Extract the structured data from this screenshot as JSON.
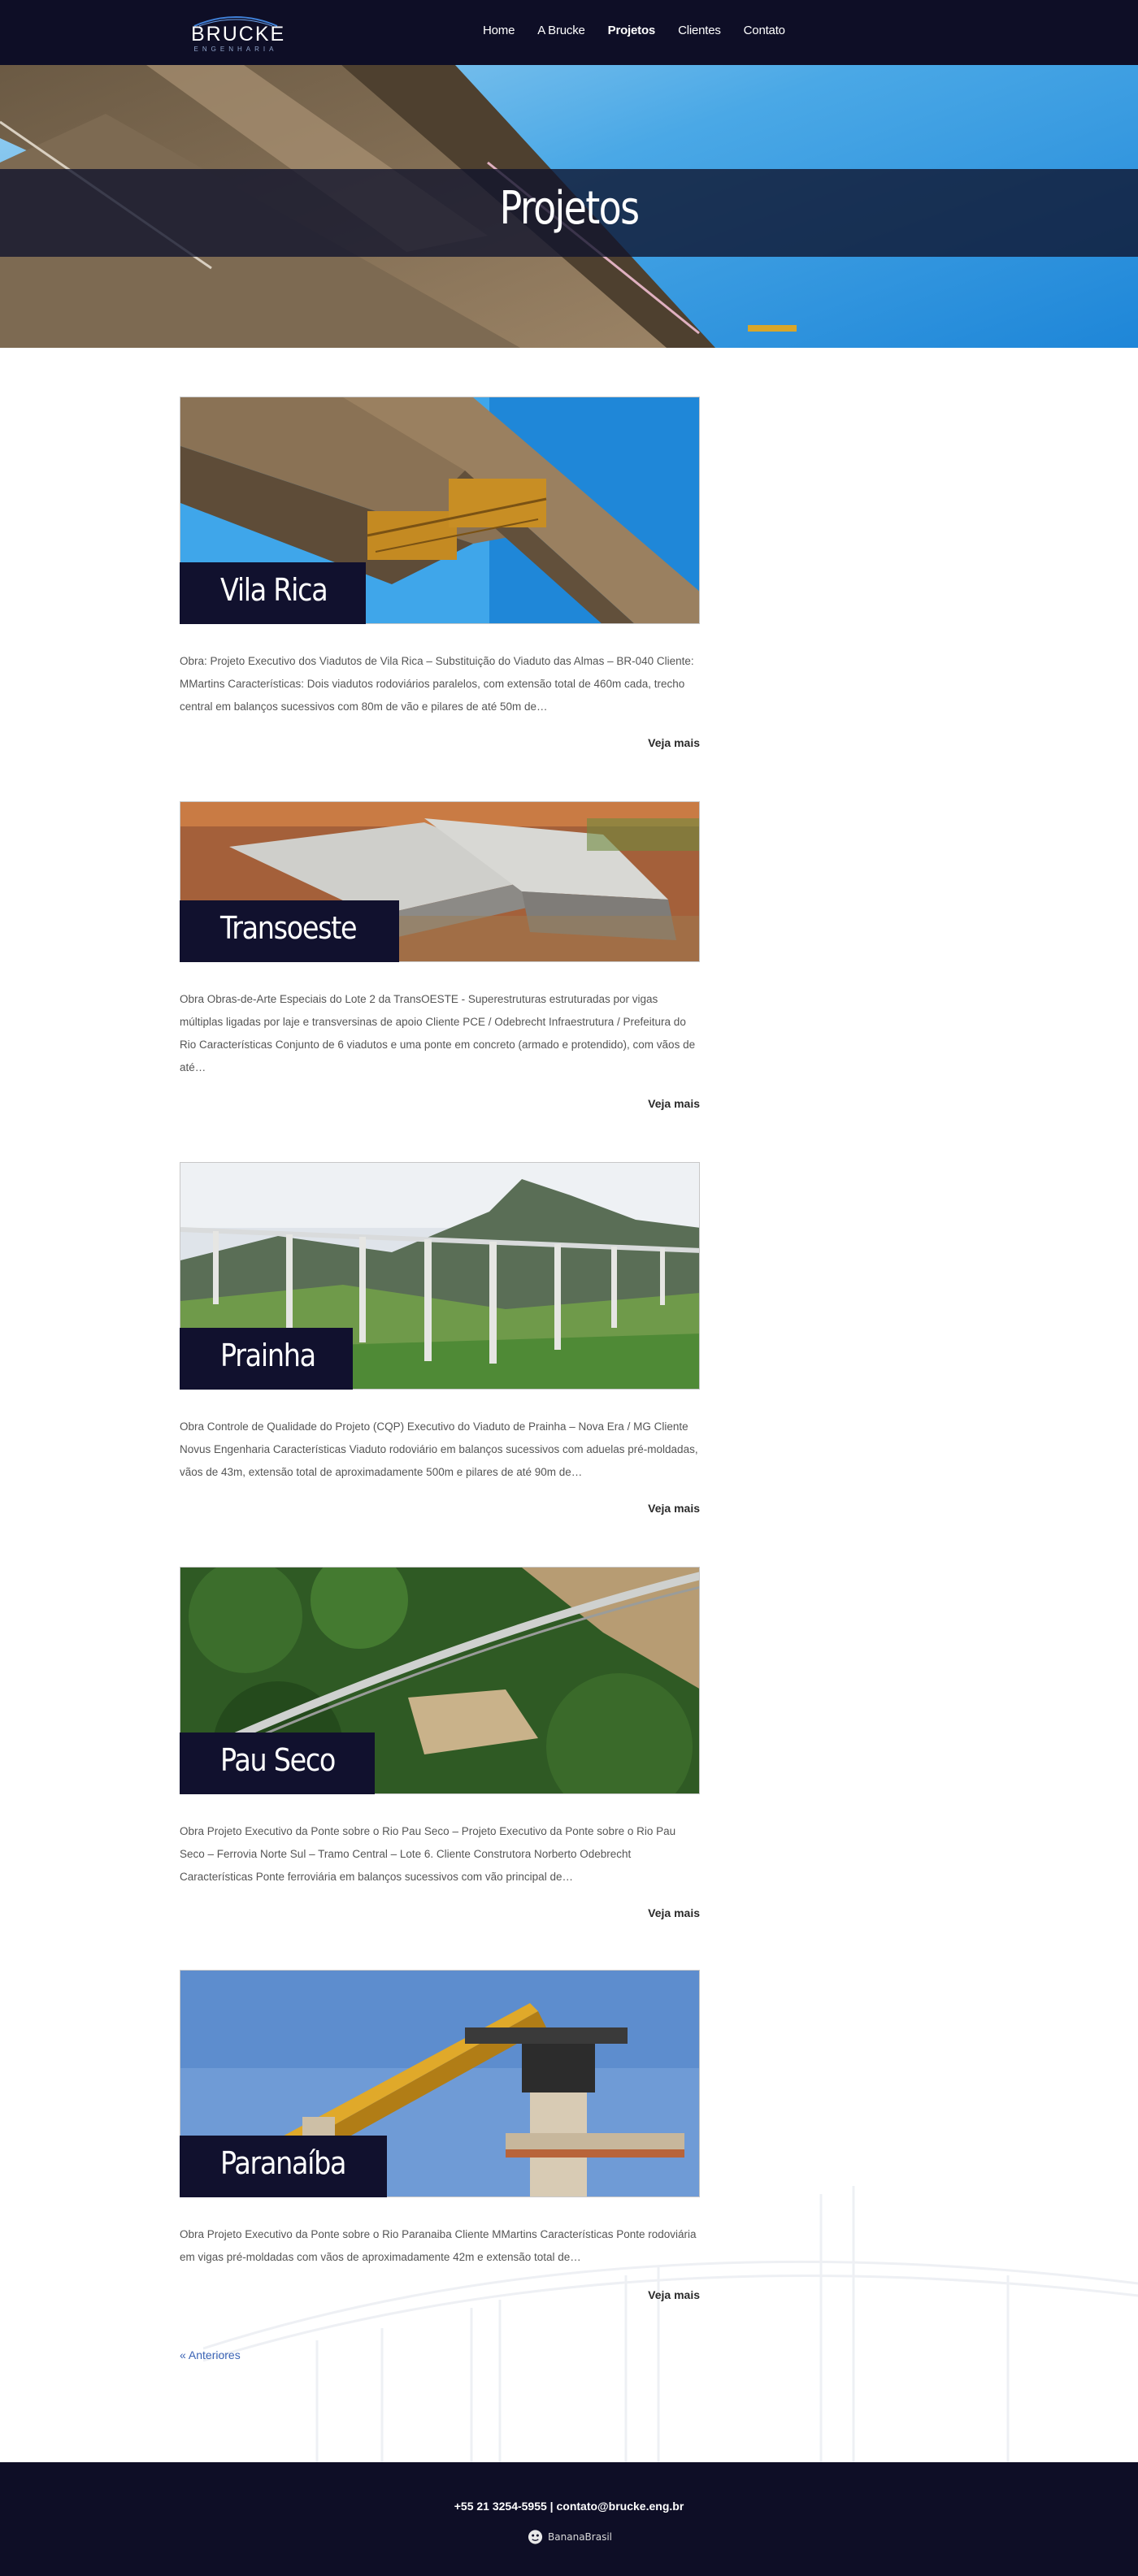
{
  "header": {
    "logo_text": "BRUCKE",
    "logo_sub": "ENGENHARIA",
    "nav": [
      {
        "label": "Home",
        "active": false
      },
      {
        "label": "A Brucke",
        "active": false
      },
      {
        "label": "Projetos",
        "active": true
      },
      {
        "label": "Clientes",
        "active": false
      },
      {
        "label": "Contato",
        "active": false
      }
    ]
  },
  "hero": {
    "title": "Projetos"
  },
  "posts": [
    {
      "title": "Vila Rica",
      "image": "viaduct-cantilever-photo",
      "excerpt": "Obra: Projeto Executivo dos Viadutos de Vila Rica – Substituição do Viaduto das Almas – BR-040 Cliente: MMartins Características: Dois viadutos rodoviários paralelos, com extensão total de 460m cada, trecho central em balanços sucessivos com 80m de vão e pilares de até 50m de…",
      "more": "Veja mais"
    },
    {
      "title": "Transoeste",
      "image": "concrete-viaduct-construction-photo",
      "excerpt": "Obra Obras-de-Arte Especiais do Lote 2 da TransOESTE - Superestruturas estruturadas por vigas múltiplas ligadas por laje e transversinas de apoio Cliente PCE / Odebrecht Infraestrutura / Prefeitura do Rio Características Conjunto de 6 viadutos e uma ponte em concreto (armado e protendido), com vãos de até…",
      "more": "Veja mais"
    },
    {
      "title": "Prainha",
      "image": "mountain-viaduct-photo",
      "excerpt": "Obra Controle de Qualidade do Projeto (CQP) Executivo do Viaduto de Prainha – Nova Era / MG Cliente Novus Engenharia Características Viaduto rodoviário em balanços sucessivos com aduelas pré-moldadas, vãos de 43m, extensão total de aproximadamente 500m e pilares de até 90m de…",
      "more": "Veja mais"
    },
    {
      "title": "Pau Seco",
      "image": "railway-bridge-forest-photo",
      "excerpt": "Obra Projeto Executivo da Ponte sobre o Rio Pau Seco – Projeto Executivo da Ponte sobre o Rio Pau Seco – Ferrovia Norte Sul – Tramo Central – Lote 6. Cliente Construtora Norberto Odebrecht Características Ponte ferroviária em balanços sucessivos com vão principal de…",
      "more": "Veja mais"
    },
    {
      "title": "Paranaíba",
      "image": "launching-gantry-photo",
      "excerpt": "Obra Projeto Executivo da Ponte sobre o Rio Paranaiba Cliente MMartins Características Ponte rodoviária em vigas pré-moldadas com vãos de aproximadamente 42m e extensão total de…",
      "more": "Veja mais"
    }
  ],
  "pagination": {
    "previous": "« Anteriores"
  },
  "footer": {
    "contact": "+55 21 3254-5955 | contato@brucke.eng.br",
    "credit": "BananaBrasil"
  },
  "colors": {
    "header_bg": "#0e0e26",
    "label_bg": "#11112e",
    "link": "#3a63b5"
  }
}
